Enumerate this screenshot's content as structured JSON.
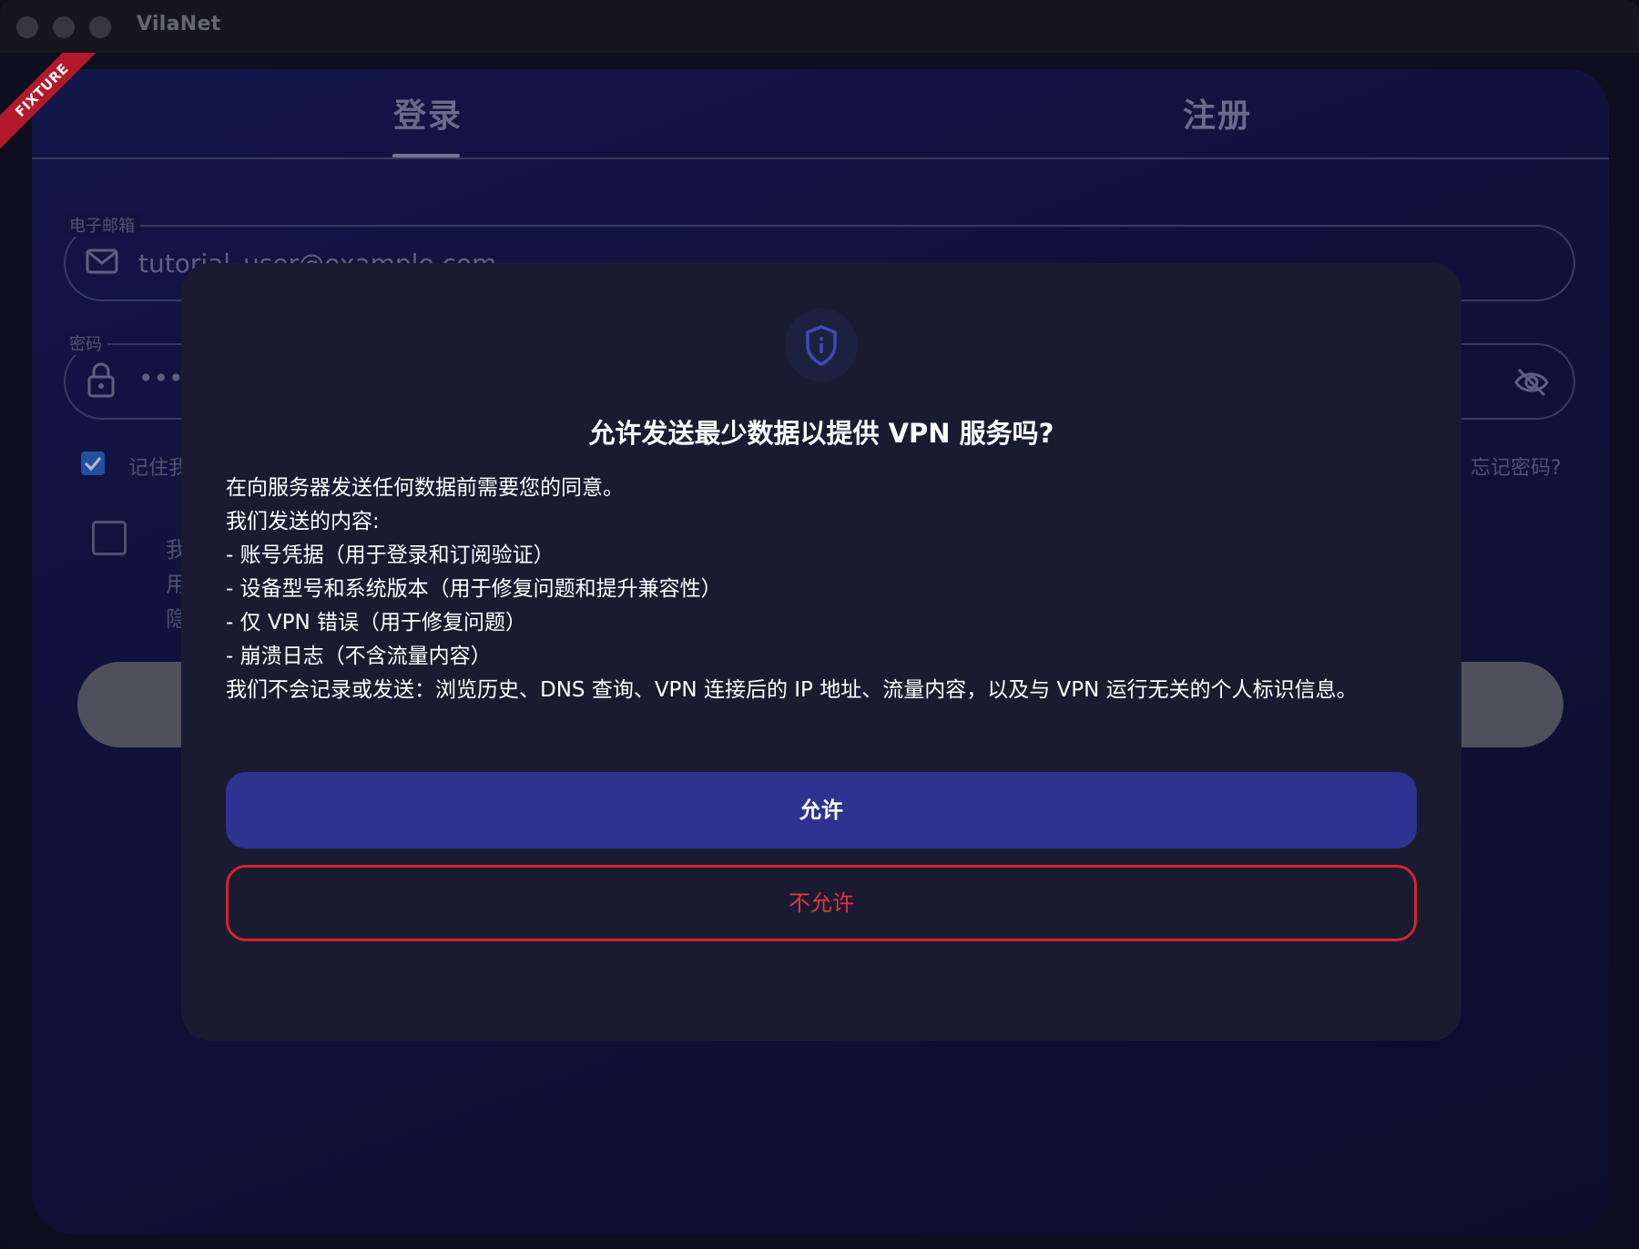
{
  "window": {
    "title": "VilaNet"
  },
  "badge": {
    "text": "FIXTURE"
  },
  "tabs": {
    "login": "登录",
    "register": "注册"
  },
  "email": {
    "label": "电子邮箱",
    "value": "tutorial_user@example.com"
  },
  "password": {
    "label": "密码",
    "value": "•••"
  },
  "remember": {
    "label": "记住我"
  },
  "forgot": {
    "label": "忘记密码?"
  },
  "terms": {
    "line1": "我",
    "line2": "用",
    "line3": "隐"
  },
  "dialog": {
    "title": "允许发送最少数据以提供 VPN 服务吗?",
    "lines": [
      "在向服务器发送任何数据前需要您的同意。",
      "我们发送的内容:",
      "- 账号凭据（用于登录和订阅验证）",
      "- 设备型号和系统版本（用于修复问题和提升兼容性）",
      "- 仅 VPN 错误（用于修复问题）",
      "- 崩溃日志（不含流量内容）",
      "我们不会记录或发送：浏览历史、DNS 查询、VPN 连接后的 IP 地址、流量内容，以及与 VPN 运行无关的个人标识信息。"
    ],
    "allow": "允许",
    "deny": "不允许"
  },
  "colors": {
    "allow_bg": "#2e3290",
    "deny": "#e53341",
    "accent": "#2d6cd6",
    "dialog_bg": "#191c31"
  },
  "icons": {
    "email": "mail-icon",
    "password": "lock-icon",
    "visibility": "eye-off-icon",
    "dialog": "shield-info-icon"
  }
}
